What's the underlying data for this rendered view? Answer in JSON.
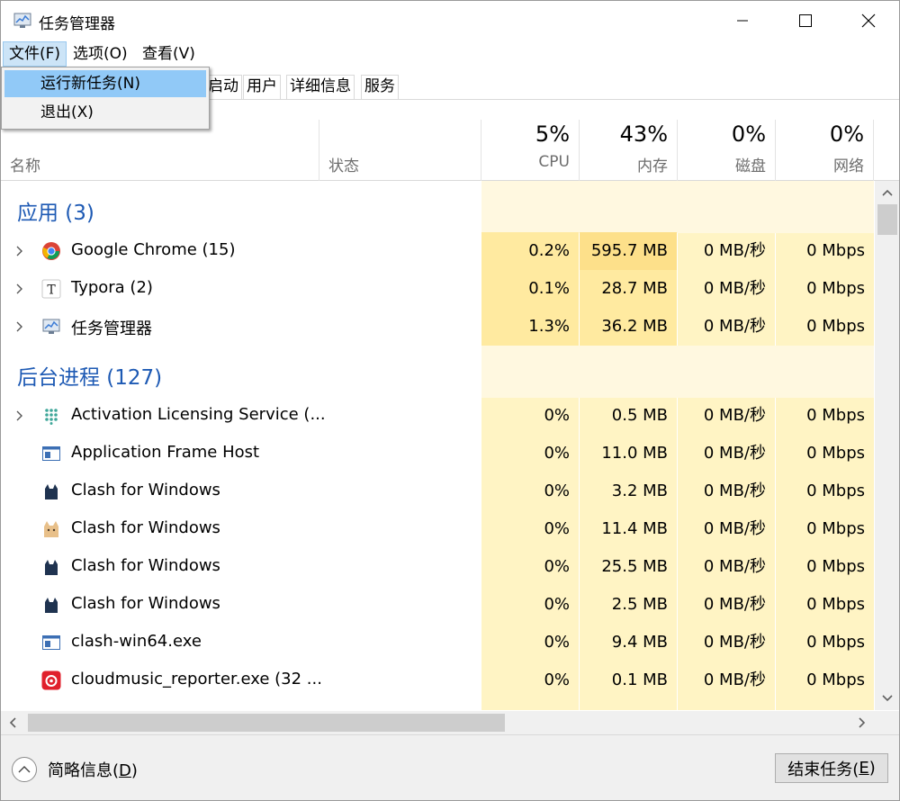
{
  "window": {
    "title": "任务管理器",
    "controls": {
      "minimize": "minimize-icon",
      "maximize": "maximize-icon",
      "close": "close-icon"
    }
  },
  "menubar": {
    "file": "文件(F)",
    "options": "选项(O)",
    "view": "查看(V)"
  },
  "file_menu": {
    "run_new_task": "运行新任务(N)",
    "exit": "退出(X)"
  },
  "tabs": {
    "startup": "启动",
    "users": "用户",
    "details": "详细信息",
    "services": "服务"
  },
  "columns": {
    "name": "名称",
    "status": "状态",
    "cpu_pct": "5%",
    "cpu": "CPU",
    "mem_pct": "43%",
    "mem": "内存",
    "disk_pct": "0%",
    "disk": "磁盘",
    "net_pct": "0%",
    "net": "网络"
  },
  "groups": {
    "apps": "应用 (3)",
    "background": "后台进程 (127)"
  },
  "apps": [
    {
      "name": "Google Chrome (15)",
      "icon": "chrome-icon",
      "cpu": "0.2%",
      "mem": "595.7 MB",
      "disk": "0 MB/秒",
      "net": "0 Mbps"
    },
    {
      "name": "Typora (2)",
      "icon": "typora-icon",
      "cpu": "0.1%",
      "mem": "28.7 MB",
      "disk": "0 MB/秒",
      "net": "0 Mbps"
    },
    {
      "name": "任务管理器",
      "icon": "task-manager-icon",
      "cpu": "1.3%",
      "mem": "36.2 MB",
      "disk": "0 MB/秒",
      "net": "0 Mbps"
    }
  ],
  "background": [
    {
      "name": "Activation Licensing Service (...",
      "icon": "dots-grid-icon",
      "cpu": "0%",
      "mem": "0.5 MB",
      "disk": "0 MB/秒",
      "net": "0 Mbps"
    },
    {
      "name": "Application Frame Host",
      "icon": "window-app-icon",
      "cpu": "0%",
      "mem": "11.0 MB",
      "disk": "0 MB/秒",
      "net": "0 Mbps"
    },
    {
      "name": "Clash for Windows",
      "icon": "cat-dark-icon",
      "cpu": "0%",
      "mem": "3.2 MB",
      "disk": "0 MB/秒",
      "net": "0 Mbps"
    },
    {
      "name": "Clash for Windows",
      "icon": "cat-tan-icon",
      "cpu": "0%",
      "mem": "11.4 MB",
      "disk": "0 MB/秒",
      "net": "0 Mbps"
    },
    {
      "name": "Clash for Windows",
      "icon": "cat-dark-icon",
      "cpu": "0%",
      "mem": "25.5 MB",
      "disk": "0 MB/秒",
      "net": "0 Mbps"
    },
    {
      "name": "Clash for Windows",
      "icon": "cat-dark-icon",
      "cpu": "0%",
      "mem": "2.5 MB",
      "disk": "0 MB/秒",
      "net": "0 Mbps"
    },
    {
      "name": "clash-win64.exe",
      "icon": "window-app-icon",
      "cpu": "0%",
      "mem": "9.4 MB",
      "disk": "0 MB/秒",
      "net": "0 Mbps"
    },
    {
      "name": "cloudmusic_reporter.exe (32 ...",
      "icon": "netease-music-icon",
      "cpu": "0%",
      "mem": "0.1 MB",
      "disk": "0 MB/秒",
      "net": "0 Mbps"
    }
  ],
  "footer": {
    "fewer_details": "简略信息(",
    "fewer_details_key": "D",
    "fewer_details_end": ")",
    "end_task": "结束任务(",
    "end_task_key": "E",
    "end_task_end": ")"
  },
  "colors": {
    "group_title": "#1e5ab4",
    "heat_low": "#fff4c4",
    "heat_mid": "#ffeaa0",
    "heat_high": "#fde08a",
    "menu_highlight": "#91c9f7"
  }
}
